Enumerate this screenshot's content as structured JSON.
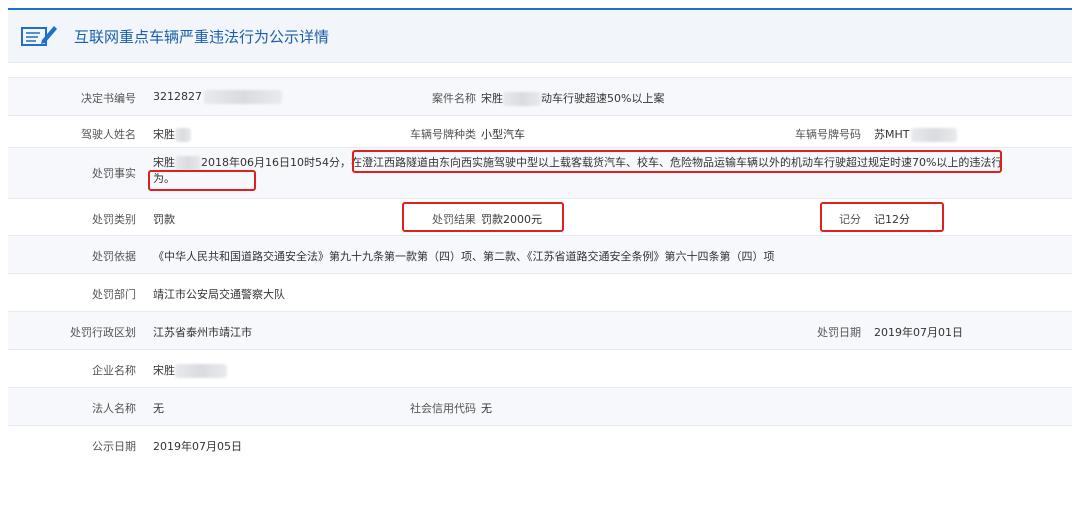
{
  "header": {
    "title": "互联网重点车辆严重违法行为公示详情"
  },
  "rows": {
    "decision_no": {
      "label": "决定书编号",
      "value": "3212827"
    },
    "case_name": {
      "label": "案件名称",
      "value_a": "宋胜",
      "value_b": "动车行驶超速50%以上案"
    },
    "driver_name": {
      "label": "驾驶人姓名",
      "value": "宋胜"
    },
    "plate_type": {
      "label": "车辆号牌种类",
      "value": "小型汽车"
    },
    "plate_no": {
      "label": "车辆号牌号码",
      "value": "苏MHT"
    },
    "facts": {
      "label": "处罚事实",
      "value_a": "宋胜",
      "value_b": "2018年06月16日10时54分，",
      "value_c": "在澄江西路隧道由东向西实施驾驶中型以上载客载货汽车、校车、危险物品运输车辆以外的机动车行驶超过规定时速70%以上的违法行为。"
    },
    "penalty_type": {
      "label": "处罚类别",
      "value": "罚款"
    },
    "penalty_result": {
      "label": "处罚结果",
      "value": "罚款2000元"
    },
    "points": {
      "label": "记分",
      "value": "记12分"
    },
    "basis": {
      "label": "处罚依据",
      "value": "《中华人民共和国道路交通安全法》第九十九条第一款第（四）项、第二款、《江苏省道路交通安全条例》第六十四条第（四）项"
    },
    "department": {
      "label": "处罚部门",
      "value": "靖江市公安局交通警察大队"
    },
    "region": {
      "label": "处罚行政区划",
      "value": "江苏省泰州市靖江市"
    },
    "penalty_date": {
      "label": "处罚日期",
      "value": "2019年07月01日"
    },
    "company": {
      "label": "企业名称",
      "value": "宋胜"
    },
    "legal_person": {
      "label": "法人名称",
      "value": "无"
    },
    "credit_code": {
      "label": "社会信用代码",
      "value": "无"
    },
    "publish_date": {
      "label": "公示日期",
      "value": "2019年07月05日"
    }
  },
  "colors": {
    "accent": "#1b5fae",
    "highlight": "#e02020"
  }
}
